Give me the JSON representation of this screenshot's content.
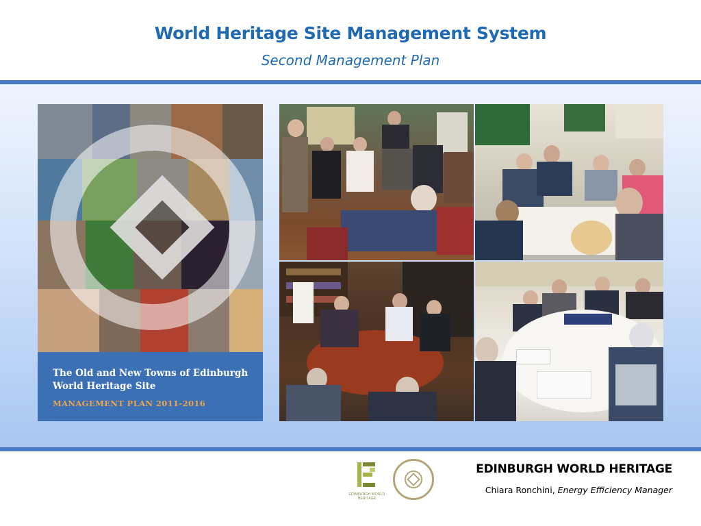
{
  "header": {
    "title": "World Heritage Site Management System",
    "subtitle": "Second Management Plan"
  },
  "cover": {
    "line1": "The Old and New Towns of Edinburgh",
    "line2": "World Heritage Site",
    "line3": "MANAGEMENT PLAN 2011-2016"
  },
  "footer": {
    "organization": "EDINBURGH WORLD HERITAGE",
    "presenter_name": "Chiara Ronchini,",
    "presenter_role": "Energy Efficiency Manager",
    "logo_caption": "EDINBURGH WORLD HERITAGE"
  },
  "colors": {
    "title_blue": "#1f6ab3",
    "rule_blue": "#4a7bc2",
    "cover_blue": "#3b70b4",
    "cover_orange": "#f0a54a"
  }
}
